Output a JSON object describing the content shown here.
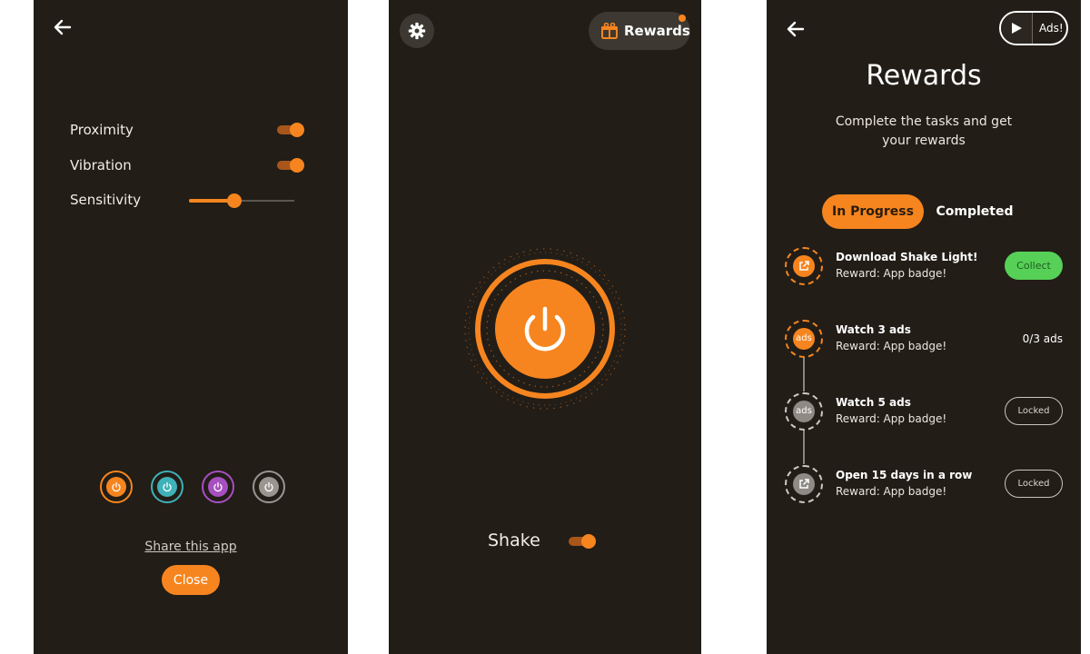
{
  "colors": {
    "accent": "#f6851f",
    "background": "#221d17",
    "collect": "#57d057"
  },
  "settings": {
    "back_icon": "arrow-left-icon",
    "proximity_label": "Proximity",
    "proximity_on": true,
    "vibration_label": "Vibration",
    "vibration_on": true,
    "sensitivity_label": "Sensitivity",
    "sensitivity_value": 0.43,
    "color_options": [
      {
        "name": "orange",
        "color": "#f6851f",
        "selected": true
      },
      {
        "name": "teal",
        "color": "#3fb1b8",
        "selected": false
      },
      {
        "name": "purple",
        "color": "#a64fc1",
        "selected": false
      },
      {
        "name": "gray",
        "color": "#9a9590",
        "selected": false
      }
    ],
    "share_label": "Share this app",
    "close_label": "Close"
  },
  "main": {
    "settings_icon": "gear-icon",
    "rewards_label": "Rewards",
    "rewards_icon": "gift-icon",
    "power_icon": "power-icon",
    "shake_label": "Shake",
    "shake_on": true
  },
  "rewards": {
    "back_icon": "arrow-left-icon",
    "ads_label": "Ads!",
    "ads_icon": "play-icon",
    "title": "Rewards",
    "subtitle": "Complete the tasks and get your rewards",
    "tabs": [
      "In Progress",
      "Completed"
    ],
    "tasks": [
      {
        "title": "Download Shake Light!",
        "reward": "Reward: App badge!",
        "icon": "external-link-icon",
        "action": "Collect"
      },
      {
        "title": "Watch 3 ads",
        "reward": "Reward: App badge!",
        "icon_text": "ads",
        "action": "0/3 ads"
      },
      {
        "title": "Watch 5 ads",
        "reward": "Reward: App badge!",
        "icon_text": "ads",
        "action": "Locked"
      },
      {
        "title": "Open 15 days in a row",
        "reward": "Reward: App badge!",
        "icon": "external-link-icon",
        "action": "Locked"
      }
    ]
  }
}
